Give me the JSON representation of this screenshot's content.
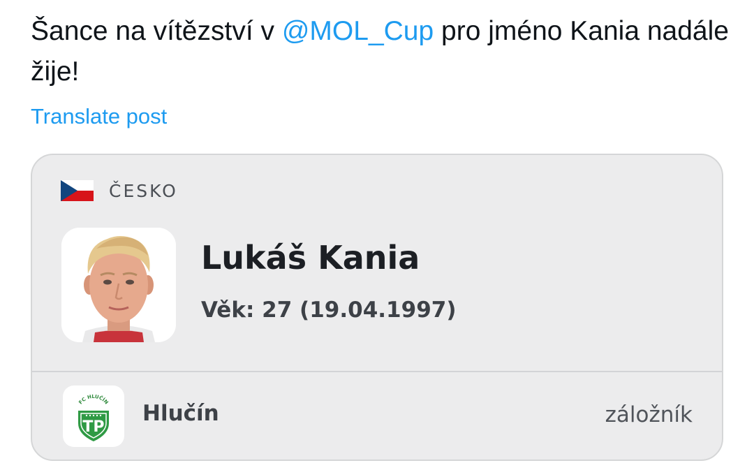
{
  "post": {
    "text_before": "Šance na vítězství v ",
    "mention": "@MOL_Cup",
    "text_after": " pro jméno Kania nadále žije!",
    "translate_label": "Translate post",
    "mention_color": "#1d9bf0"
  },
  "card": {
    "country": {
      "flag_icon": "czech-flag-icon",
      "name": "ČESKO"
    },
    "player": {
      "photo_icon": "player-photo",
      "name": "Lukáš Kania",
      "age": "Věk: 27 (19.04.1997)"
    },
    "club": {
      "logo_icon": "fc-hlucin-logo-icon",
      "logo_text": "FC HLUČÍN",
      "name": "Hlučín",
      "position": "záložník"
    }
  }
}
